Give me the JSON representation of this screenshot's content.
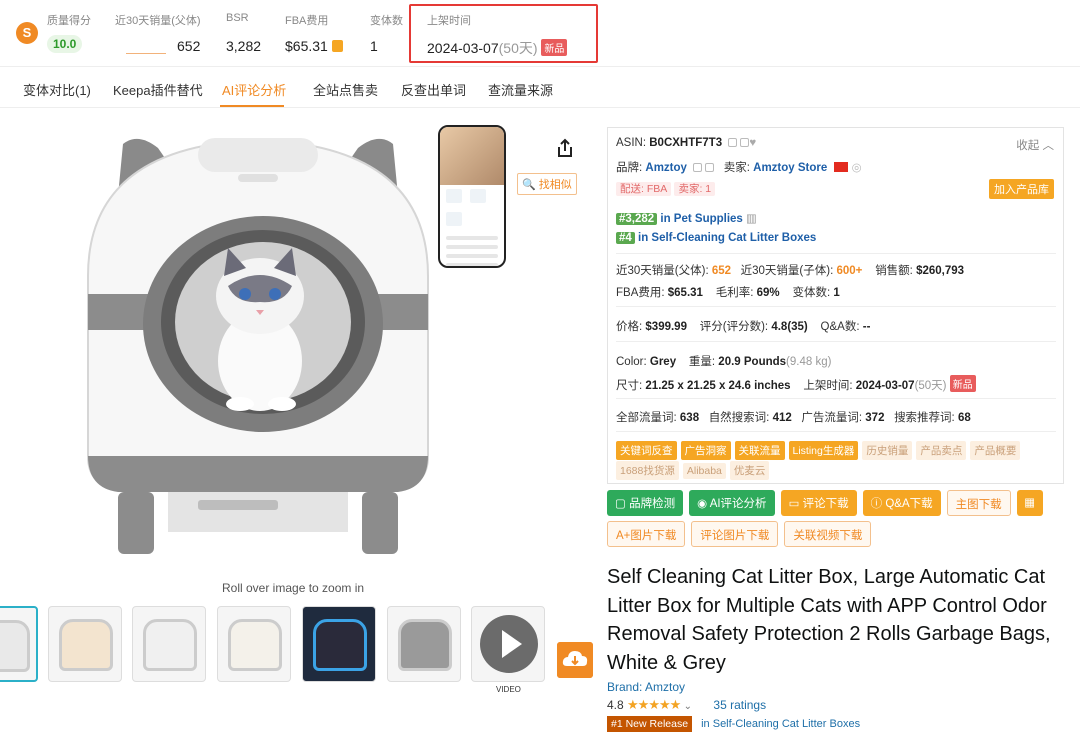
{
  "stats": {
    "quality_label": "质量得分",
    "quality_value": "10.0",
    "sales30_label": "近30天销量(父体)",
    "sales30_value": "652",
    "bsr_label": "BSR",
    "bsr_value": "3,282",
    "fba_label": "FBA费用",
    "fba_value": "$65.31",
    "variants_label": "变体数",
    "variants_value": "1",
    "launch_label": "上架时间",
    "launch_date": "2024-03-07",
    "launch_days": "(50天)",
    "new_tag": "新品"
  },
  "tabs": [
    "变体对比(1)",
    "Keepa插件替代",
    "AI评论分析",
    "全站点售卖",
    "反查出单词",
    "查流量来源"
  ],
  "gallery": {
    "find_similar": "找相似",
    "rollover": "Roll over image to zoom in",
    "video_label": "VIDEO"
  },
  "panel": {
    "asin_label": "ASIN:",
    "asin_value": "B0CXHTF7T3",
    "collapse": "收起",
    "brand_label": "品牌:",
    "brand_value": "Amztoy",
    "seller_label": "卖家:",
    "seller_value": "Amztoy Store",
    "ship_tag": "配送: FBA",
    "sellers_tag": "卖家: 1",
    "add_library": "加入产品库",
    "rank1_badge": "#3,282",
    "rank1_text": "in Pet Supplies",
    "rank2_badge": "#4",
    "rank2_text": "in Self-Cleaning Cat Litter Boxes",
    "sales_parent_label": "近30天销量(父体):",
    "sales_parent_value": "652",
    "sales_child_label": "近30天销量(子体):",
    "sales_child_value": "600+",
    "revenue_label": "销售额:",
    "revenue_value": "$260,793",
    "fba_label": "FBA费用:",
    "fba_value": "$65.31",
    "margin_label": "毛利率:",
    "margin_value": "69%",
    "variants_label": "变体数:",
    "variants_value": "1",
    "price_label": "价格:",
    "price_value": "$399.99",
    "rating_label": "评分(评分数):",
    "rating_value": "4.8(35)",
    "qa_label": "Q&A数:",
    "qa_value": "--",
    "color_label": "Color:",
    "color_value": "Grey",
    "weight_label": "重量:",
    "weight_value": "20.9 Pounds",
    "weight_kg": "(9.48 kg)",
    "size_label": "尺寸:",
    "size_value": "21.25 x 21.25 x 24.6 inches",
    "launch_label": "上架时间:",
    "launch_value": "2024-03-07",
    "launch_days": "(50天)",
    "new_tag": "新品",
    "traffic_all_label": "全部流量词:",
    "traffic_all_value": "638",
    "traffic_natural_label": "自然搜索词:",
    "traffic_natural_value": "412",
    "traffic_ad_label": "广告流量词:",
    "traffic_ad_value": "372",
    "traffic_rec_label": "搜索推荐词:",
    "traffic_rec_value": "68",
    "tags_row1_solid": [
      "关键词反查",
      "广告洞察",
      "关联流量",
      "Listing生成器"
    ],
    "tags_row1_light": [
      "历史销量",
      "产品卖点",
      "产品概要"
    ],
    "tags_row2_light": [
      "1688找货源",
      "Alibaba",
      "优麦云"
    ]
  },
  "buttons": {
    "brand_check": "品牌检测",
    "ai_review": "AI评论分析",
    "review_download": "评论下载",
    "qa_download": "Q&A下载",
    "main_image_download": "主图下载",
    "aplus_download": "A+图片下载",
    "review_image_download": "评论图片下载",
    "related_video_download": "关联视频下载"
  },
  "product": {
    "title": "Self Cleaning Cat Litter Box, Large Automatic Cat Litter Box for Multiple Cats with APP Control Odor Removal Safety Protection 2 Rolls Garbage Bags, White & Grey",
    "brand": "Brand: Amztoy",
    "rating_value": "4.8",
    "stars": "★★★★★",
    "ratings_count": "35 ratings",
    "new_release_badge": "#1 New Release",
    "new_release_in": "in Self-Cleaning Cat Litter Boxes"
  },
  "colors": {
    "accent": "#f08a24",
    "highlight_border": "#e53935",
    "link": "#1e6fa8",
    "green": "#2eaa5b"
  }
}
